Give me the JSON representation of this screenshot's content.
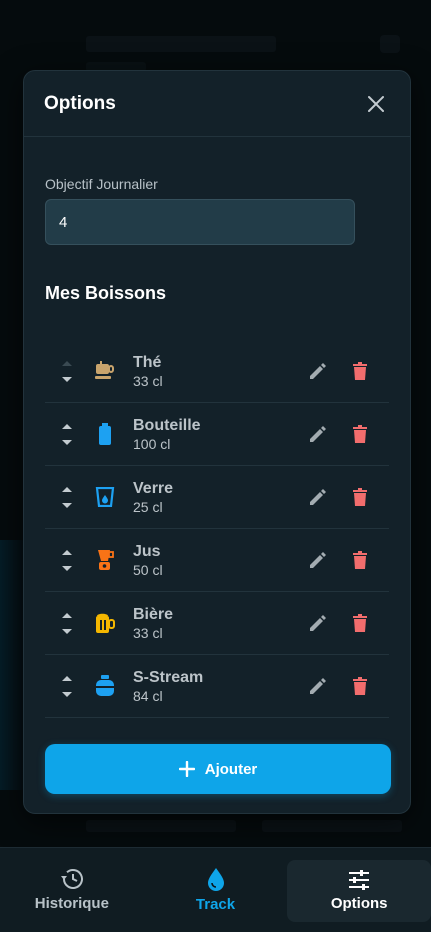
{
  "modal": {
    "title": "Options",
    "goal_label": "Objectif Journalier",
    "goal_value": "4",
    "section_title": "Mes Boissons",
    "add_label": "Ajouter"
  },
  "drinks": [
    {
      "name": "Thé",
      "volume": "33 cl",
      "icon": "tea-cup-icon",
      "color": "#c9a46c"
    },
    {
      "name": "Bouteille",
      "volume": "100 cl",
      "icon": "bottle-icon",
      "color": "#1da1f2"
    },
    {
      "name": "Verre",
      "volume": "25 cl",
      "icon": "glass-icon",
      "color": "#1da1f2"
    },
    {
      "name": "Jus",
      "volume": "50 cl",
      "icon": "blender-icon",
      "color": "#f97316"
    },
    {
      "name": "Bière",
      "volume": "33 cl",
      "icon": "beer-mug-icon",
      "color": "#f5b700"
    },
    {
      "name": "S-Stream",
      "volume": "84 cl",
      "icon": "flask-icon",
      "color": "#1da1f2"
    }
  ],
  "nav": {
    "history": "Historique",
    "track": "Track",
    "options": "Options"
  },
  "colors": {
    "accent": "#0ea5e9",
    "delete": "#f26d6d",
    "edit": "#a3acb1"
  }
}
